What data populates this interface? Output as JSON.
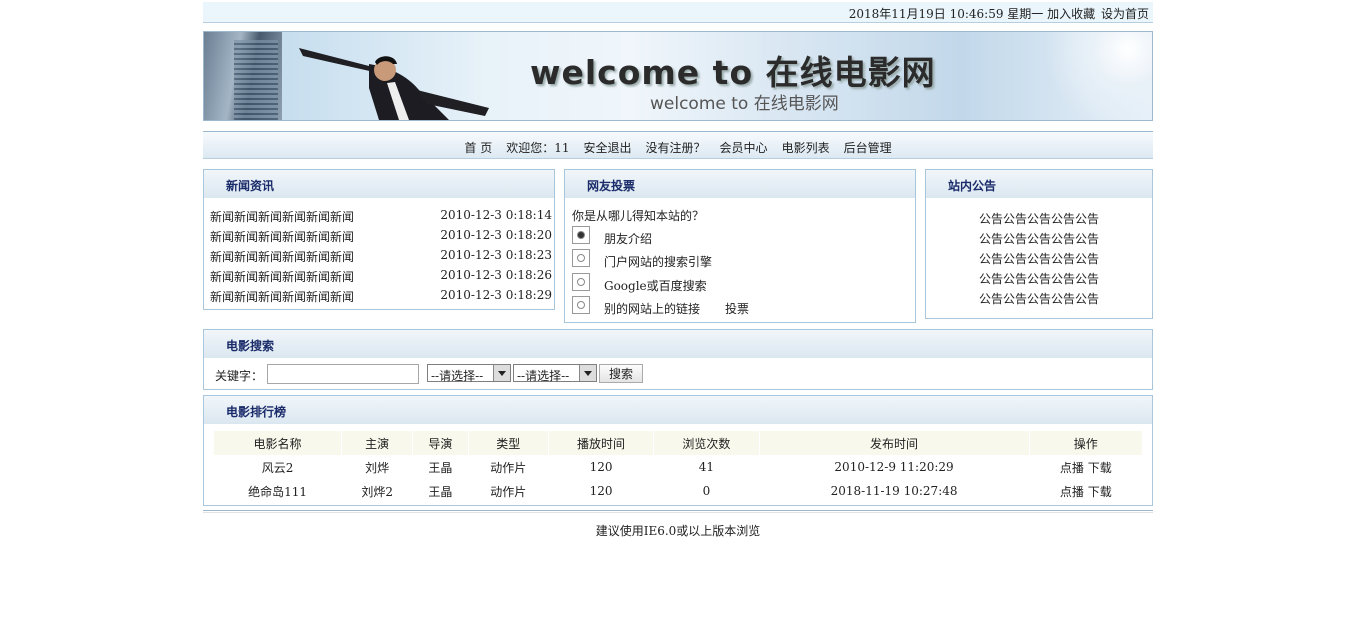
{
  "topbar": {
    "datetime": "2018年11月19日 10:46:59 星期一",
    "bookmark": "加入收藏",
    "homepage": "设为首页"
  },
  "banner": {
    "title": "welcome to 在线电影网",
    "subtitle": "welcome to 在线电影网"
  },
  "nav": {
    "items": [
      "首 页",
      "欢迎您：11",
      "安全退出",
      "没有注册？",
      "会员中心",
      "电影列表",
      "后台管理"
    ]
  },
  "news": {
    "title": "新闻资讯",
    "rows": [
      {
        "name": "新闻新闻新闻新闻新闻新闻",
        "date": "2010-12-3 0:18:14"
      },
      {
        "name": "新闻新闻新闻新闻新闻新闻",
        "date": "2010-12-3 0:18:20"
      },
      {
        "name": "新闻新闻新闻新闻新闻新闻",
        "date": "2010-12-3 0:18:23"
      },
      {
        "name": "新闻新闻新闻新闻新闻新闻",
        "date": "2010-12-3 0:18:26"
      },
      {
        "name": "新闻新闻新闻新闻新闻新闻",
        "date": "2010-12-3 0:18:29"
      }
    ]
  },
  "vote": {
    "title": "网友投票",
    "question": "你是从哪儿得知本站的？",
    "options": [
      "朋友介绍",
      "门户网站的搜索引擎",
      "Google或百度搜索",
      "别的网站上的链接"
    ],
    "selected_index": 0,
    "submit": "投票"
  },
  "notice": {
    "title": "站内公告",
    "rows": [
      "公告公告公告公告公告",
      "公告公告公告公告公告",
      "公告公告公告公告公告",
      "公告公告公告公告公告",
      "公告公告公告公告公告"
    ]
  },
  "search": {
    "title": "电影搜索",
    "keyword_label": "关键字：",
    "keyword_value": "",
    "select1": "--请选择--",
    "select2": "--请选择--",
    "button": "搜索"
  },
  "rank": {
    "title": "电影排行榜",
    "columns": [
      "电影名称",
      "主演",
      "导演",
      "类型",
      "播放时间",
      "浏览次数",
      "发布时间",
      "操作"
    ],
    "rows": [
      {
        "name": "风云2",
        "actor": "刘烨",
        "director": "王晶",
        "type": "动作片",
        "duration": "120",
        "views": "41",
        "published": "2010-12-9 11:20:29",
        "play": "点播",
        "download": "下载"
      },
      {
        "name": "绝命岛111",
        "actor": "刘烨2",
        "director": "王晶",
        "type": "动作片",
        "duration": "120",
        "views": "0",
        "published": "2018-11-19 10:27:48",
        "play": "点播",
        "download": "下载"
      }
    ]
  },
  "footer": {
    "text": "建议使用IE6.0或以上版本浏览"
  }
}
